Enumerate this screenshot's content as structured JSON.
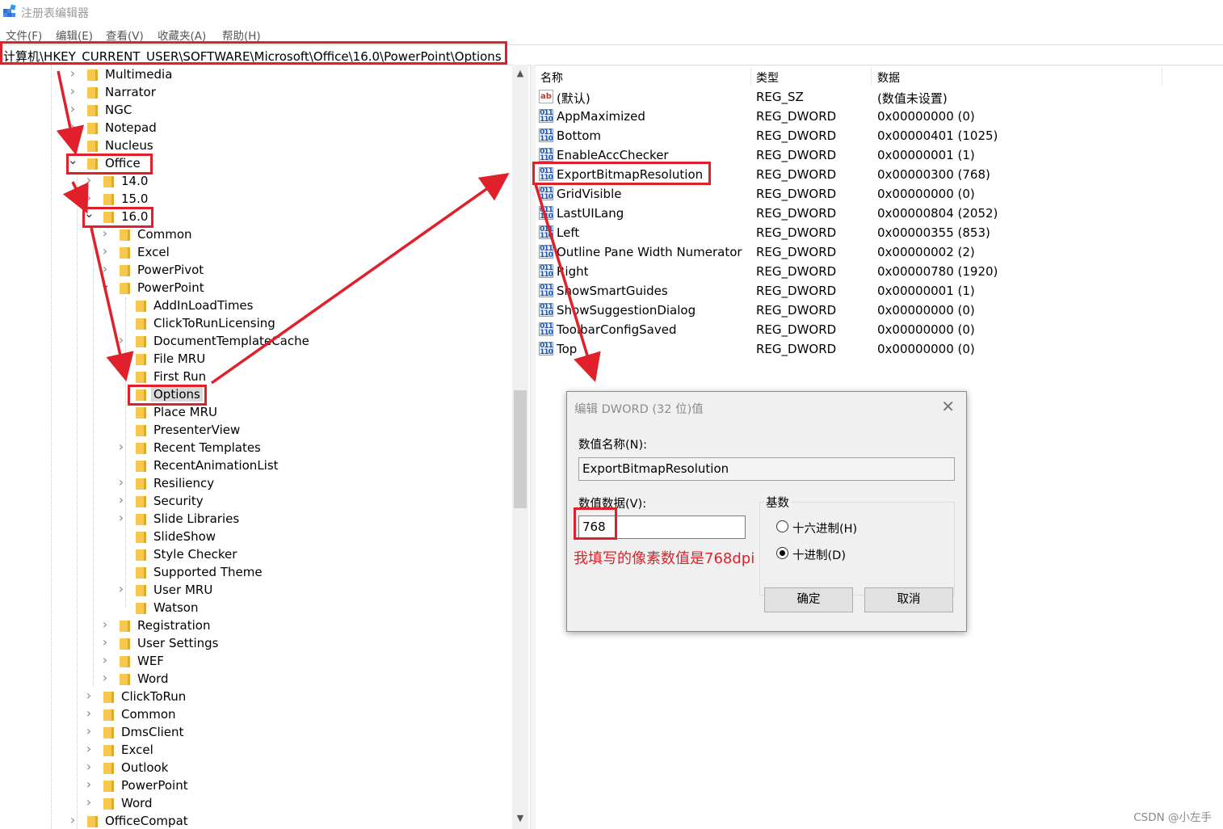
{
  "window": {
    "title": "注册表编辑器"
  },
  "menu": [
    "文件(F)",
    "编辑(E)",
    "查看(V)",
    "收藏夹(A)",
    "帮助(H)"
  ],
  "address": "计算机\\HKEY_CURRENT_USER\\SOFTWARE\\Microsoft\\Office\\16.0\\PowerPoint\\Options",
  "tree": [
    {
      "label": "Multimedia",
      "depth": 0,
      "state": "collapsed"
    },
    {
      "label": "Narrator",
      "depth": 0,
      "state": "collapsed"
    },
    {
      "label": "NGC",
      "depth": 0,
      "state": "collapsed"
    },
    {
      "label": "Notepad",
      "depth": 0,
      "state": "collapsed"
    },
    {
      "label": "Nucleus",
      "depth": 0,
      "state": "collapsed"
    },
    {
      "label": "Office",
      "depth": 0,
      "state": "expanded"
    },
    {
      "label": "14.0",
      "depth": 1,
      "state": "collapsed"
    },
    {
      "label": "15.0",
      "depth": 1,
      "state": "collapsed"
    },
    {
      "label": "16.0",
      "depth": 1,
      "state": "expanded"
    },
    {
      "label": "Common",
      "depth": 2,
      "state": "collapsed"
    },
    {
      "label": "Excel",
      "depth": 2,
      "state": "collapsed"
    },
    {
      "label": "PowerPivot",
      "depth": 2,
      "state": "collapsed"
    },
    {
      "label": "PowerPoint",
      "depth": 2,
      "state": "expanded"
    },
    {
      "label": "AddInLoadTimes",
      "depth": 3,
      "state": "none"
    },
    {
      "label": "ClickToRunLicensing",
      "depth": 3,
      "state": "none"
    },
    {
      "label": "DocumentTemplateCache",
      "depth": 3,
      "state": "collapsed"
    },
    {
      "label": "File MRU",
      "depth": 3,
      "state": "none"
    },
    {
      "label": "First Run",
      "depth": 3,
      "state": "none"
    },
    {
      "label": "Options",
      "depth": 3,
      "state": "none",
      "selected": true
    },
    {
      "label": "Place MRU",
      "depth": 3,
      "state": "none"
    },
    {
      "label": "PresenterView",
      "depth": 3,
      "state": "none"
    },
    {
      "label": "Recent Templates",
      "depth": 3,
      "state": "collapsed"
    },
    {
      "label": "RecentAnimationList",
      "depth": 3,
      "state": "none"
    },
    {
      "label": "Resiliency",
      "depth": 3,
      "state": "collapsed"
    },
    {
      "label": "Security",
      "depth": 3,
      "state": "collapsed"
    },
    {
      "label": "Slide Libraries",
      "depth": 3,
      "state": "collapsed"
    },
    {
      "label": "SlideShow",
      "depth": 3,
      "state": "none"
    },
    {
      "label": "Style Checker",
      "depth": 3,
      "state": "none"
    },
    {
      "label": "Supported Theme",
      "depth": 3,
      "state": "none"
    },
    {
      "label": "User MRU",
      "depth": 3,
      "state": "collapsed"
    },
    {
      "label": "Watson",
      "depth": 3,
      "state": "none"
    },
    {
      "label": "Registration",
      "depth": 2,
      "state": "collapsed"
    },
    {
      "label": "User Settings",
      "depth": 2,
      "state": "collapsed"
    },
    {
      "label": "WEF",
      "depth": 2,
      "state": "collapsed"
    },
    {
      "label": "Word",
      "depth": 2,
      "state": "collapsed"
    },
    {
      "label": "ClickToRun",
      "depth": 1,
      "state": "collapsed"
    },
    {
      "label": "Common",
      "depth": 1,
      "state": "collapsed"
    },
    {
      "label": "DmsClient",
      "depth": 1,
      "state": "collapsed"
    },
    {
      "label": "Excel",
      "depth": 1,
      "state": "collapsed"
    },
    {
      "label": "Outlook",
      "depth": 1,
      "state": "collapsed"
    },
    {
      "label": "PowerPoint",
      "depth": 1,
      "state": "collapsed"
    },
    {
      "label": "Word",
      "depth": 1,
      "state": "collapsed"
    },
    {
      "label": "OfficeCompat",
      "depth": 0,
      "state": "collapsed"
    }
  ],
  "columns": {
    "name": "名称",
    "type": "类型",
    "data": "数据"
  },
  "values": [
    {
      "icon": "string",
      "name": "(默认)",
      "type": "REG_SZ",
      "data": "(数值未设置)"
    },
    {
      "icon": "dword",
      "name": "AppMaximized",
      "type": "REG_DWORD",
      "data": "0x00000000 (0)"
    },
    {
      "icon": "dword",
      "name": "Bottom",
      "type": "REG_DWORD",
      "data": "0x00000401 (1025)"
    },
    {
      "icon": "dword",
      "name": "EnableAccChecker",
      "type": "REG_DWORD",
      "data": "0x00000001 (1)"
    },
    {
      "icon": "dword",
      "name": "ExportBitmapResolution",
      "type": "REG_DWORD",
      "data": "0x00000300 (768)",
      "selected": true
    },
    {
      "icon": "dword",
      "name": "GridVisible",
      "type": "REG_DWORD",
      "data": "0x00000000 (0)"
    },
    {
      "icon": "dword",
      "name": "LastUILang",
      "type": "REG_DWORD",
      "data": "0x00000804 (2052)"
    },
    {
      "icon": "dword",
      "name": "Left",
      "type": "REG_DWORD",
      "data": "0x00000355 (853)"
    },
    {
      "icon": "dword",
      "name": "Outline Pane Width Numerator",
      "type": "REG_DWORD",
      "data": "0x00000002 (2)"
    },
    {
      "icon": "dword",
      "name": "Right",
      "type": "REG_DWORD",
      "data": "0x00000780 (1920)"
    },
    {
      "icon": "dword",
      "name": "ShowSmartGuides",
      "type": "REG_DWORD",
      "data": "0x00000001 (1)"
    },
    {
      "icon": "dword",
      "name": "ShowSuggestionDialog",
      "type": "REG_DWORD",
      "data": "0x00000000 (0)"
    },
    {
      "icon": "dword",
      "name": "ToolbarConfigSaved",
      "type": "REG_DWORD",
      "data": "0x00000000 (0)"
    },
    {
      "icon": "dword",
      "name": "Top",
      "type": "REG_DWORD",
      "data": "0x00000000 (0)"
    }
  ],
  "dialog": {
    "title": "编辑 DWORD (32 位)值",
    "name_label": "数值名称(N):",
    "name_value": "ExportBitmapResolution",
    "data_label": "数值数据(V):",
    "data_value": "768",
    "base_label": "基数",
    "hex_label": "十六进制(H)",
    "dec_label": "十进制(D)",
    "base_selected": "dec",
    "ok": "确定",
    "cancel": "取消"
  },
  "annotation": "我填写的像素数值是768dpi",
  "watermark": "CSDN @小左手",
  "colors": {
    "highlight": "#e0202a",
    "folder": "#f6c84d",
    "selection": "#d9d9d9"
  }
}
